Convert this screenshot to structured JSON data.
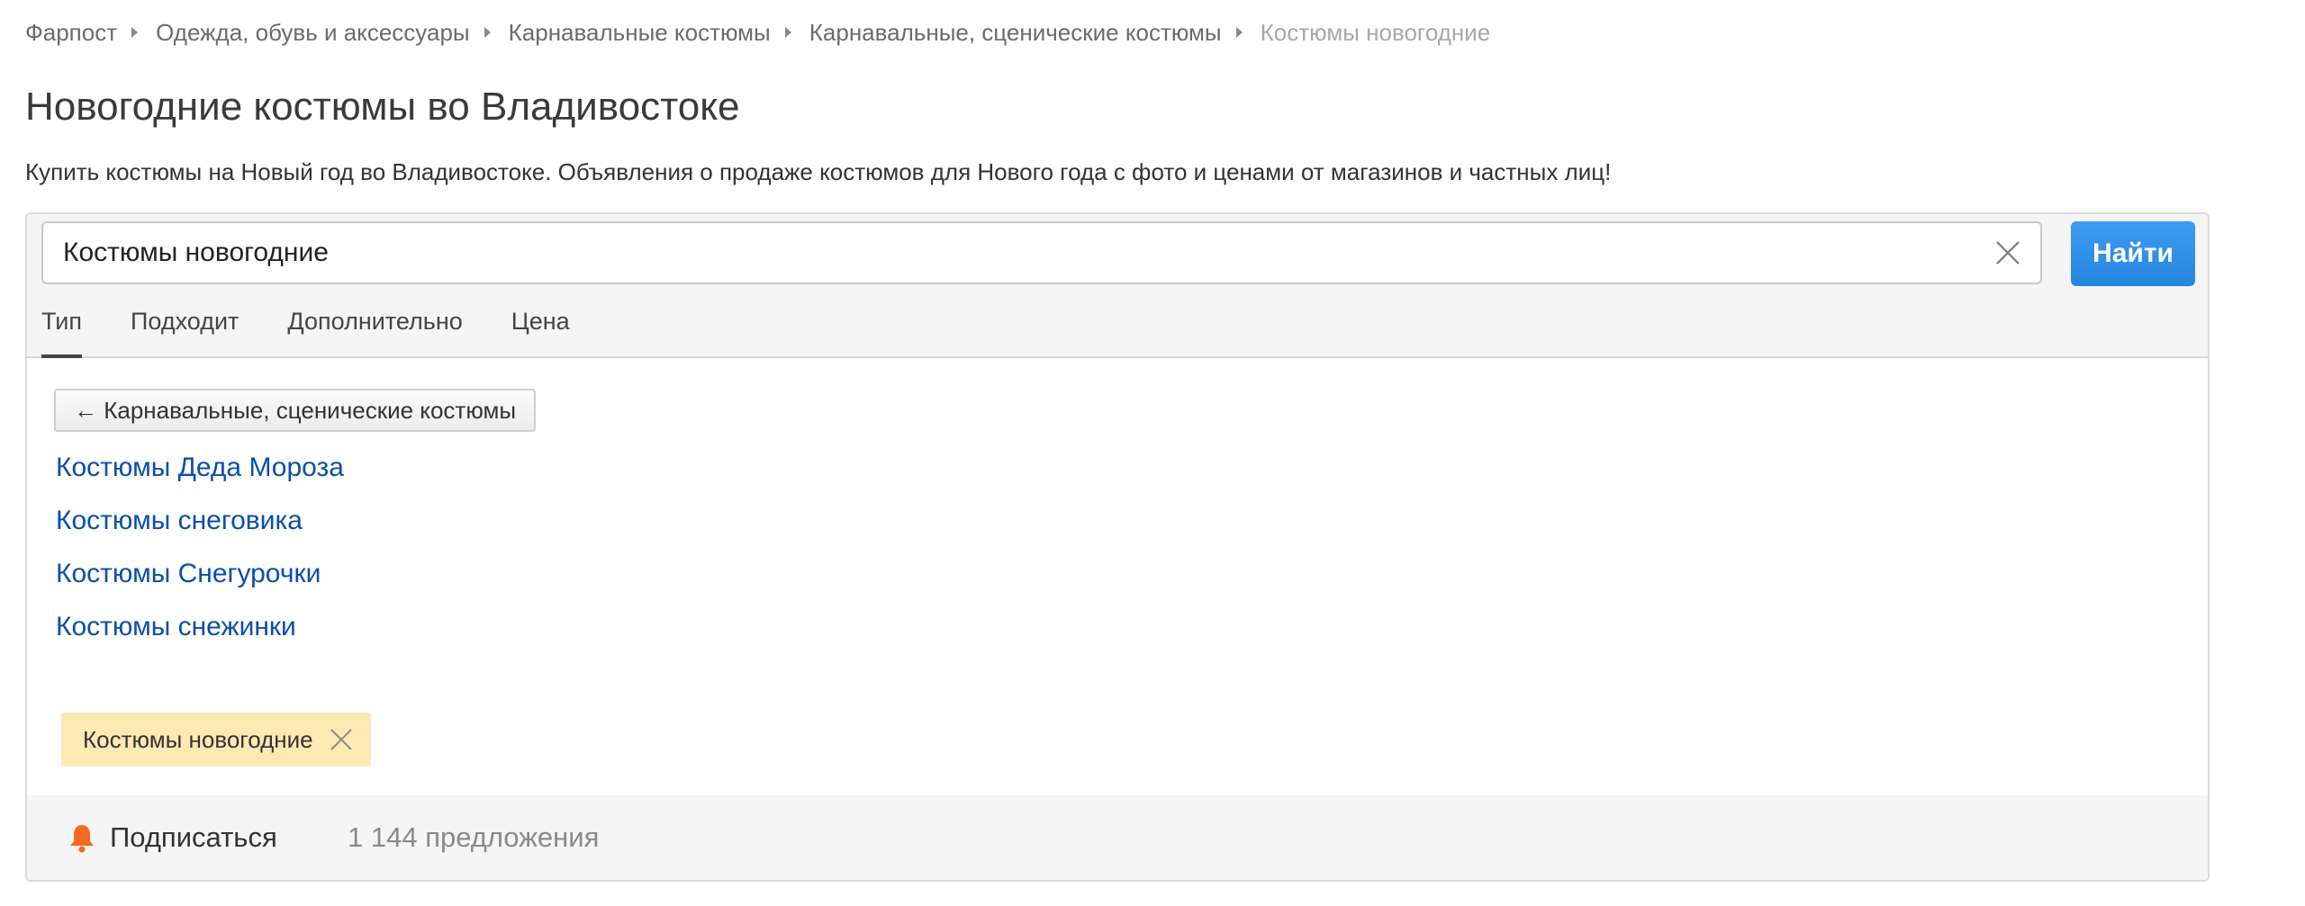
{
  "breadcrumb": {
    "items": [
      "Фарпост",
      "Одежда, обувь и аксессуары",
      "Карнавальные костюмы",
      "Карнавальные, сценические костюмы"
    ],
    "current": "Костюмы новогодние"
  },
  "header": {
    "title": "Новогодние костюмы во Владивостоке",
    "description": "Купить костюмы на Новый год во Владивостоке. Объявления о продаже костюмов для Нового года с фото и ценами от магазинов и частных лиц!"
  },
  "search": {
    "value": "Костюмы новогодние",
    "button_label": "Найти"
  },
  "tabs": [
    {
      "label": "Тип",
      "active": true
    },
    {
      "label": "Подходит",
      "active": false
    },
    {
      "label": "Дополнительно",
      "active": false
    },
    {
      "label": "Цена",
      "active": false
    }
  ],
  "filters": {
    "back_label": "← Карнавальные, сценические костюмы",
    "subcategories": [
      "Костюмы Деда Мороза",
      "Костюмы снеговика",
      "Костюмы Снегурочки",
      "Костюмы снежинки"
    ],
    "selected_chip": "Костюмы новогодние"
  },
  "footer": {
    "subscribe_label": "Подписаться",
    "offers_count": "1 144 предложения"
  },
  "colors": {
    "accent_button": "#2f8fe8",
    "link": "#0b4fa8",
    "chip_bg": "#fde9b4",
    "bell": "#f26a21"
  },
  "icons": {
    "clear": "close-icon",
    "chip_remove": "close-icon",
    "subscribe": "bell-icon"
  }
}
